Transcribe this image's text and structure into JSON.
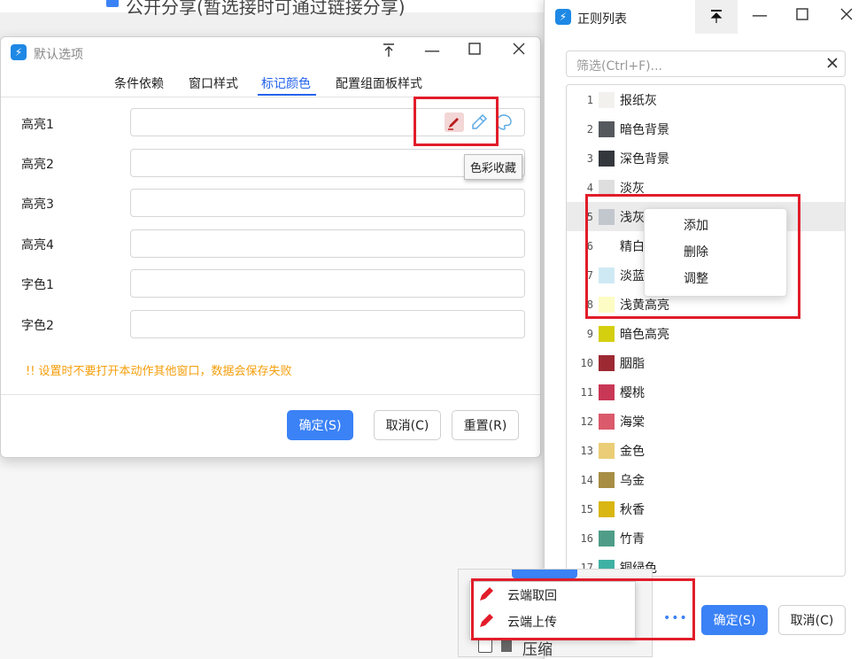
{
  "background": {
    "behind_text": "公开分享(暂选接时可通过链接分享)",
    "bottom_item": "压缩"
  },
  "dialog": {
    "title": "默认选项",
    "tabs": [
      {
        "label": "条件依赖",
        "active": false
      },
      {
        "label": "窗口样式",
        "active": false
      },
      {
        "label": "标记颜色",
        "active": true
      },
      {
        "label": "配置组面板样式",
        "active": false
      }
    ],
    "rows": [
      {
        "label": "高亮1",
        "value": ""
      },
      {
        "label": "高亮2",
        "value": ""
      },
      {
        "label": "高亮3",
        "value": ""
      },
      {
        "label": "高亮4",
        "value": ""
      },
      {
        "label": "字色1",
        "value": ""
      },
      {
        "label": "字色2",
        "value": ""
      }
    ],
    "tooltip": "色彩收藏",
    "warning": "!! 设置时不要打开本动作其他窗口，数据会保存失败",
    "buttons": {
      "ok": "确定(S)",
      "cancel": "取消(C)",
      "reset": "重置(R)"
    }
  },
  "panel": {
    "title": "正则列表",
    "filter_placeholder": "筛选(Ctrl+F)...",
    "items": [
      {
        "index": "1",
        "name": "报纸灰",
        "color": "#f2f1ee"
      },
      {
        "index": "2",
        "name": "暗色背景",
        "color": "#55585d"
      },
      {
        "index": "3",
        "name": "深色背景",
        "color": "#34373c"
      },
      {
        "index": "4",
        "name": "淡灰",
        "color": "#dedede"
      },
      {
        "index": "5",
        "name": "浅灰",
        "color": "#c2c6cd"
      },
      {
        "index": "6",
        "name": "精白",
        "color": "#ffffff"
      },
      {
        "index": "7",
        "name": "淡蓝",
        "color": "#cfe9f4"
      },
      {
        "index": "8",
        "name": "浅黄高亮",
        "color": "#fdfcc4"
      },
      {
        "index": "9",
        "name": "暗色高亮",
        "color": "#d4cf0f"
      },
      {
        "index": "10",
        "name": "胭脂",
        "color": "#9d2933"
      },
      {
        "index": "11",
        "name": "樱桃",
        "color": "#c93756"
      },
      {
        "index": "12",
        "name": "海棠",
        "color": "#db5a6b"
      },
      {
        "index": "13",
        "name": "金色",
        "color": "#eacd76"
      },
      {
        "index": "14",
        "name": "乌金",
        "color": "#a78e44"
      },
      {
        "index": "15",
        "name": "秋香",
        "color": "#d9b611"
      },
      {
        "index": "16",
        "name": "竹青",
        "color": "#4f9d88"
      },
      {
        "index": "17",
        "name": "铜绿色",
        "color": "#3fb1a4"
      }
    ],
    "context_menu": [
      "添加",
      "删除",
      "调整"
    ],
    "more": "•••",
    "ok": "确定(S)",
    "cancel": "取消(C)"
  },
  "popup": {
    "items": [
      "云端取回",
      "云端上传"
    ]
  },
  "colors": {
    "accent": "#3b82f6",
    "highlight_box": "#e11d2a",
    "warning": "#f59e0b"
  }
}
